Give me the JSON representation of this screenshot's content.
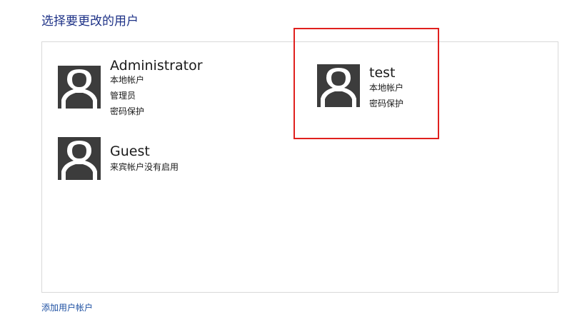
{
  "page_title": "选择要更改的用户",
  "accounts": [
    {
      "name": "Administrator",
      "details": [
        "本地帐户",
        "管理员",
        "密码保护"
      ]
    },
    {
      "name": "test",
      "details": [
        "本地帐户",
        "密码保护"
      ]
    },
    {
      "name": "Guest",
      "details": [
        "来宾帐户没有启用"
      ]
    }
  ],
  "add_account_link": "添加用户帐户",
  "colors": {
    "title": "#1e3287",
    "link": "#1e50a2",
    "avatar_bg": "#3c3c3c",
    "highlight": "#e0201e"
  }
}
